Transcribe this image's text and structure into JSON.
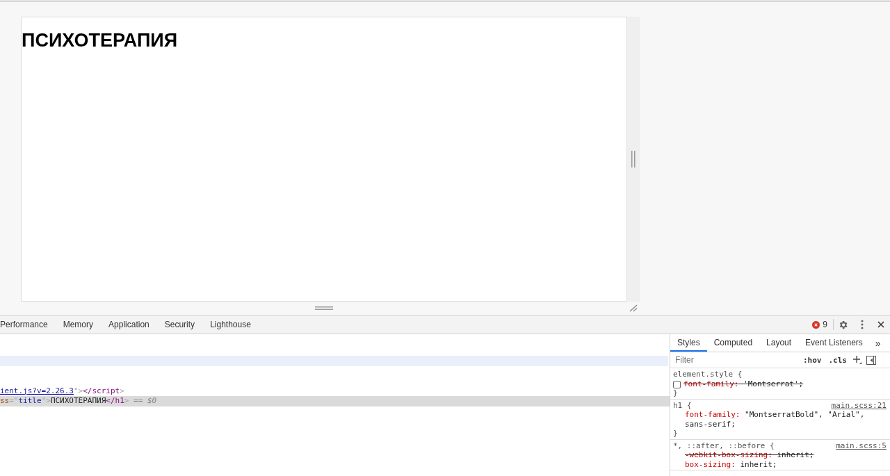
{
  "page": {
    "heading": "ПСИХОТЕРАПИЯ"
  },
  "devtools": {
    "tabs": [
      {
        "label": "Performance",
        "selected": false
      },
      {
        "label": "Memory",
        "selected": false
      },
      {
        "label": "Application",
        "selected": false
      },
      {
        "label": "Security",
        "selected": false
      },
      {
        "label": "Lighthouse",
        "selected": false
      }
    ],
    "error_count": "9",
    "elements": {
      "rows": [
        {
          "hovered": false,
          "selected": false,
          "tokens": []
        },
        {
          "hovered": false,
          "selected": false,
          "tokens": []
        },
        {
          "hovered": true,
          "selected": false,
          "tokens": []
        },
        {
          "hovered": false,
          "selected": false,
          "tokens": []
        },
        {
          "hovered": false,
          "selected": false,
          "tokens": []
        },
        {
          "hovered": false,
          "selected": false,
          "tokens": [
            {
              "kind": "link",
              "text": "ient.js?v=2.26.3"
            },
            {
              "kind": "punct",
              "text": "\">"
            },
            {
              "kind": "tag",
              "text": "</script"
            },
            {
              "kind": "punct",
              "text": ">"
            }
          ]
        },
        {
          "hovered": false,
          "selected": true,
          "tokens": [
            {
              "kind": "attr",
              "text": "ss"
            },
            {
              "kind": "punct",
              "text": "=\""
            },
            {
              "kind": "value",
              "text": "title"
            },
            {
              "kind": "punct",
              "text": "\">"
            },
            {
              "kind": "text",
              "text": "ПСИХОТЕРАПИЯ"
            },
            {
              "kind": "tag",
              "text": "</h1"
            },
            {
              "kind": "punct",
              "text": ">"
            },
            {
              "kind": "console",
              "text": " == $0"
            }
          ]
        }
      ]
    },
    "styles": {
      "tabs": [
        {
          "label": "Styles",
          "selected": true
        },
        {
          "label": "Computed",
          "selected": false
        },
        {
          "label": "Layout",
          "selected": false
        },
        {
          "label": "Event Listeners",
          "selected": false
        }
      ],
      "more": "»",
      "filter": {
        "placeholder": "Filter"
      },
      "hov": ":hov",
      "cls": ".cls",
      "rules": [
        {
          "selector": "element.style",
          "open": "{",
          "close": "}",
          "declarations": [
            {
              "property": "font-family:",
              "value": "'Montserrat';",
              "disabled": true,
              "overridden": true
            }
          ]
        },
        {
          "selector": "h1",
          "open": "{",
          "close": "}",
          "source": "main.scss:21",
          "declarations": [
            {
              "property": "font-family:",
              "value": "\"MontserratBold\", \"Arial\", sans-serif;",
              "disabled": false,
              "overridden": false
            }
          ]
        },
        {
          "selector": "*, ::after, ::before",
          "open": "{",
          "source": "main.scss:5",
          "declarations": [
            {
              "property": "-webkit-box-sizing:",
              "value": "inherit;",
              "disabled": false,
              "overridden": true
            },
            {
              "property": "box-sizing:",
              "value": "inherit;",
              "disabled": false,
              "overridden": false
            }
          ]
        }
      ]
    }
  }
}
